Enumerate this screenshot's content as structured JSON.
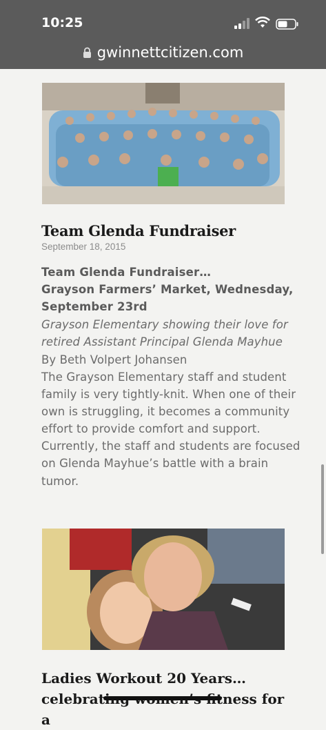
{
  "status": {
    "time": "10:25"
  },
  "browser": {
    "url": "gwinnettcitizen.com"
  },
  "article1": {
    "title": "Team Glenda Fundraiser",
    "date": "September 18, 2015",
    "heading_lines": [
      "Team Glenda Fundraiser…",
      "Grayson Farmers’ Market, Wednesday,",
      "September 23rd"
    ],
    "caption_lines": [
      "Grayson Elementary showing their love for",
      "retired Assistant Principal Glenda Mayhue"
    ],
    "byline": "By Beth Volpert Johansen",
    "body_lines": [
      "The Grayson Elementary staff and student",
      "family is very tightly-knit. When one of their",
      "own is struggling, it becomes a community",
      "effort to provide comfort and support.",
      "Currently, the staff and students are focused",
      "on Glenda Mayhue’s battle with a brain",
      "tumor."
    ]
  },
  "article2": {
    "title_lines": [
      "Ladies Workout 20 Years…",
      "celebrating women’s fitness for a"
    ]
  },
  "colors": {
    "statusbar": "#5b5b5b",
    "page": "#f3f3f1",
    "title": "#1a1a1a"
  }
}
